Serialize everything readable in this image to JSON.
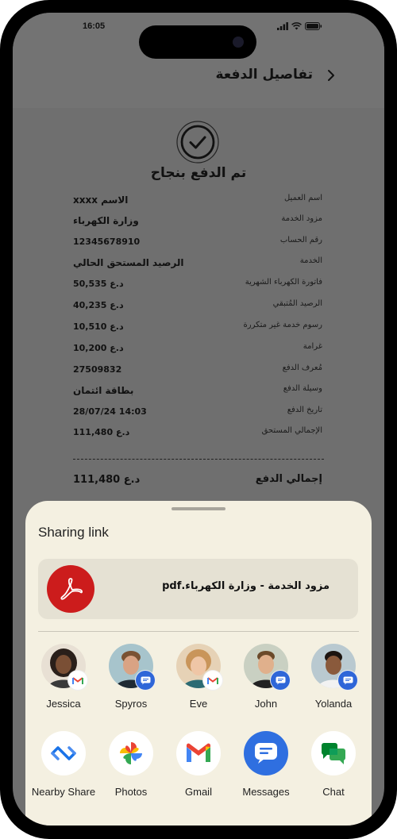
{
  "status_bar": {
    "time": "16:05"
  },
  "header": {
    "title": "تفاصيل الدفعة"
  },
  "success": {
    "title": "تم الدفع بنجاح"
  },
  "details": [
    {
      "label": "اسم العميل",
      "value": "الاسم xxxx"
    },
    {
      "label": "مزود الخدمة",
      "value": "وزارة الكهرباء"
    },
    {
      "label": "رقم الحساب",
      "value": "12345678910"
    },
    {
      "label": "الخدمة",
      "value": "الرصيد المستحق الحالي"
    },
    {
      "label": "فاتورة الكهرباء الشهرية",
      "value": "50,535 د.ع"
    },
    {
      "label": "الرصيد المُتبقي",
      "value": "40,235 د.ع"
    },
    {
      "label": "رسوم خدمة  غير متكررة",
      "value": "10,510 د.ع"
    },
    {
      "label": "غرامة",
      "value": "10,200 د.ع"
    },
    {
      "label": "مُعرف الدفع",
      "value": "27509832"
    },
    {
      "label": "وسيلة الدفع",
      "value": "بطاقة ائتمان"
    },
    {
      "label": "تاريخ الدفع",
      "value": "28/07/24 14:03"
    },
    {
      "label": "الإجمالي المستحق",
      "value": "111,480 د.ع"
    }
  ],
  "total": {
    "label": "إجمالي الدفع",
    "value": "111,480 د.ع"
  },
  "share_sheet": {
    "title": "Sharing link",
    "file_name": "مزود الخدمة - وزارة الكهرباء.pdf",
    "contacts": [
      {
        "name": "Jessica",
        "badge": "gmail-icon"
      },
      {
        "name": "Spyros",
        "badge": "messages-icon"
      },
      {
        "name": "Eve",
        "badge": "gmail-icon"
      },
      {
        "name": "John",
        "badge": "messages-icon"
      },
      {
        "name": "Yolanda",
        "badge": "messages-icon"
      }
    ],
    "apps": [
      {
        "name": "Nearby Share",
        "icon": "nearby-share-icon"
      },
      {
        "name": "Photos",
        "icon": "photos-icon"
      },
      {
        "name": "Gmail",
        "icon": "gmail-icon"
      },
      {
        "name": "Messages",
        "icon": "messages-icon"
      },
      {
        "name": "Chat",
        "icon": "chat-icon"
      }
    ]
  },
  "colors": {
    "overlay": "#6f6f6f",
    "sheet_background": "#f4f0e1",
    "file_card": "#e5e1d3",
    "pdf_red": "#cc1c1c",
    "messages_blue": "#2f6fe0"
  }
}
